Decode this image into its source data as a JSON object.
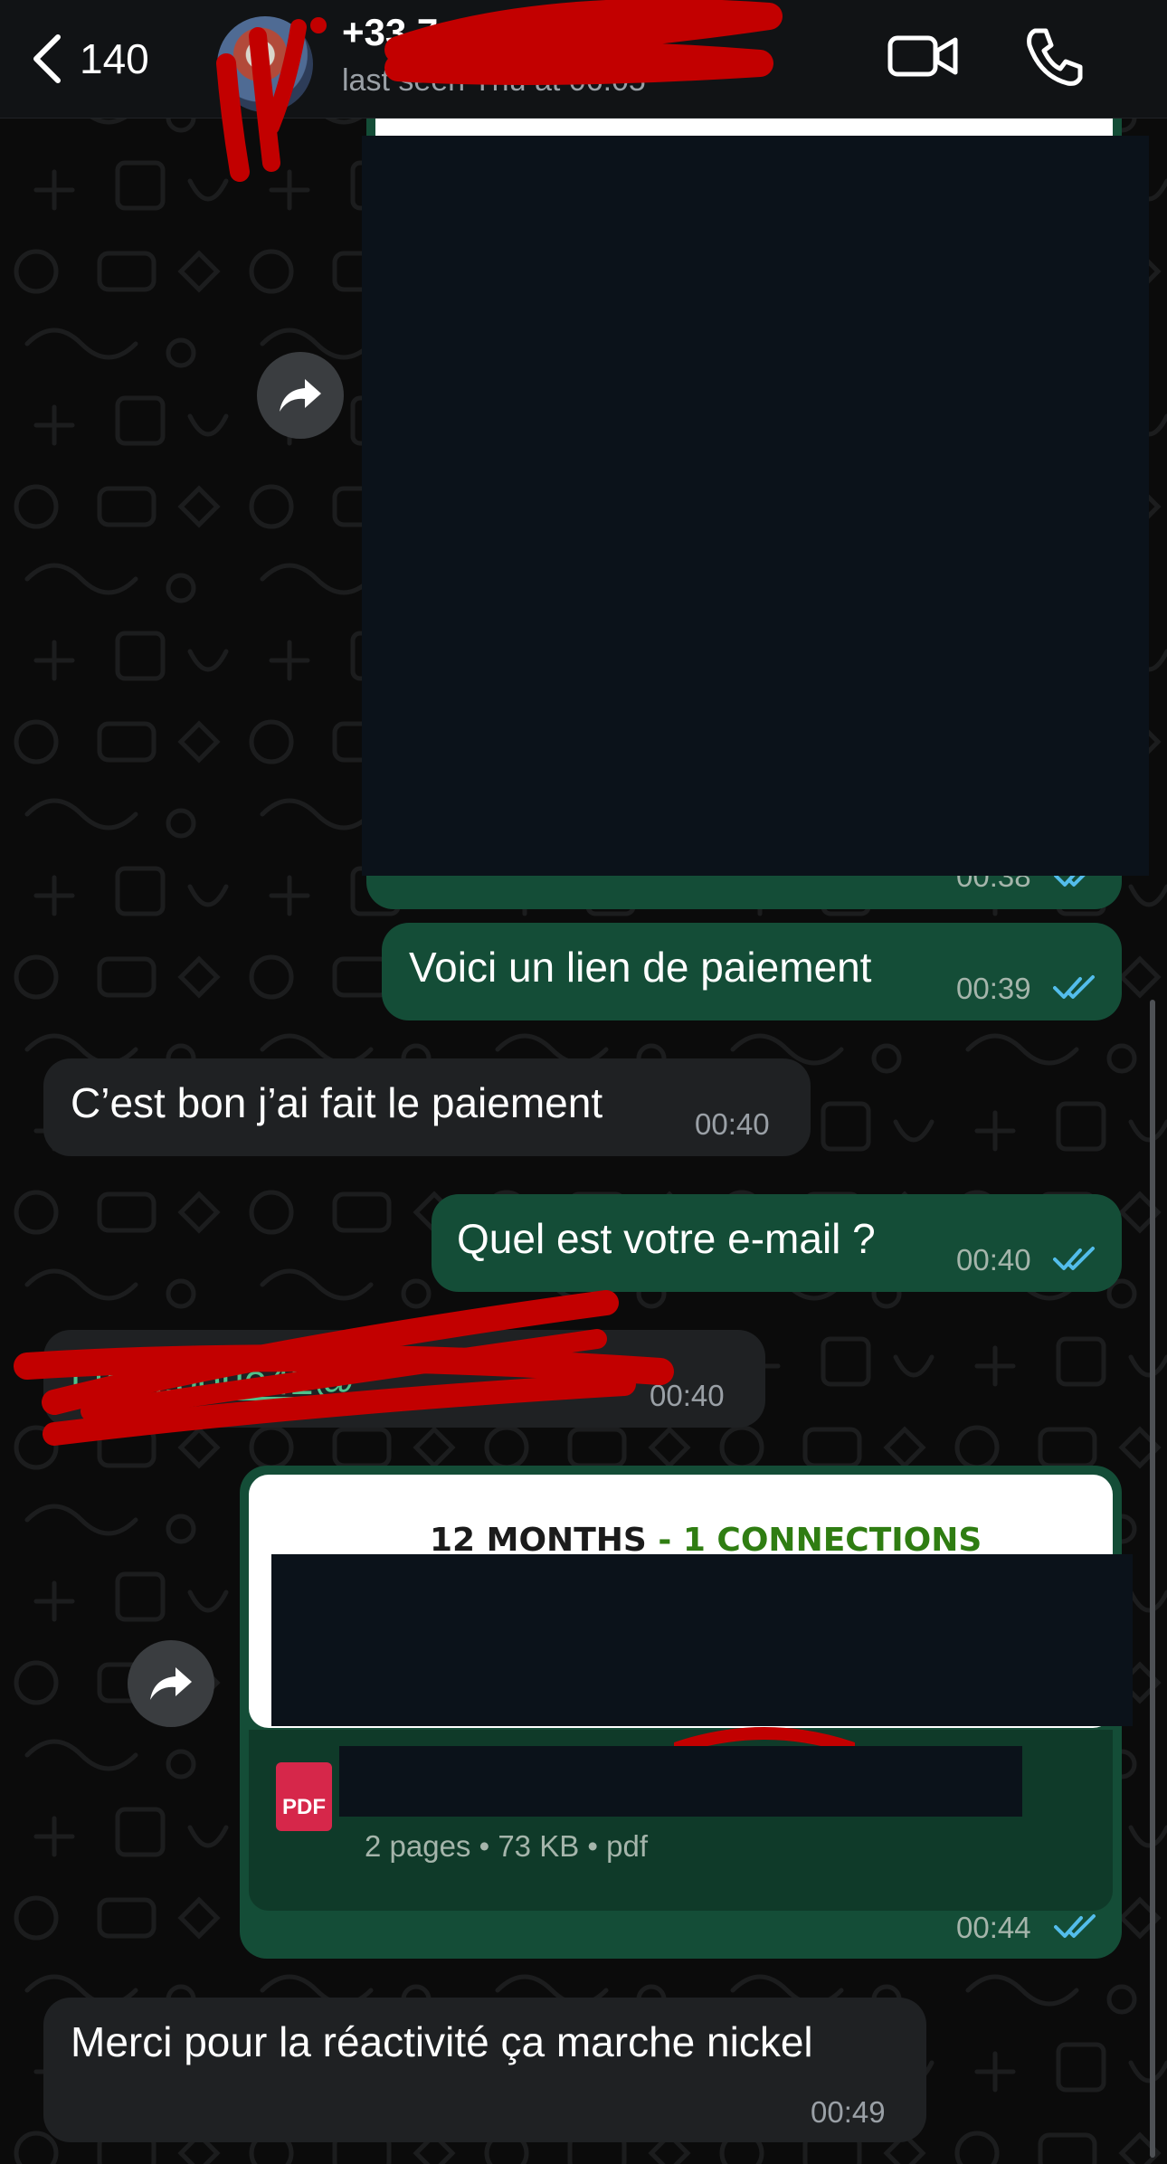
{
  "header": {
    "back_count": "140",
    "contact_name": "+33 7",
    "last_seen": "last seen Thu at 06:05"
  },
  "messages": [
    {
      "direction": "outgoing",
      "type": "image",
      "time": "00:38",
      "status": "read"
    },
    {
      "direction": "outgoing",
      "type": "text",
      "text": "Voici un lien de paiement",
      "time": "00:39",
      "status": "read"
    },
    {
      "direction": "incoming",
      "type": "text",
      "text": "C’est bon j’ai fait le paiement",
      "time": "00:40"
    },
    {
      "direction": "outgoing",
      "type": "text",
      "text": "Quel est votre e-mail ?",
      "time": "00:40",
      "status": "read"
    },
    {
      "direction": "incoming",
      "type": "text",
      "text": "t.tom.boue42@",
      "time": "00:40"
    },
    {
      "direction": "outgoing",
      "type": "document",
      "preview_title_a": "12 MONTHS",
      "preview_title_sep": " - ",
      "preview_title_b": "1 CONNECTIONS",
      "file_badge": "PDF",
      "file_meta": "2 pages • 73 KB • pdf",
      "time": "00:44",
      "status": "read"
    },
    {
      "direction": "incoming",
      "type": "text",
      "text": "Merci pour la réactivité ça marche nickel",
      "time": "00:49"
    }
  ],
  "colors": {
    "outgoing_bubble": "#144d37",
    "incoming_bubble": "#1f2123",
    "read_ticks": "#53bdeb",
    "redaction_marker": "#c20000"
  },
  "icons": {
    "back": "chevron-left-icon",
    "video": "video-camera-icon",
    "call": "phone-icon",
    "forward": "forward-arrow-icon",
    "read": "double-check-icon",
    "document": "pdf-file-icon"
  }
}
